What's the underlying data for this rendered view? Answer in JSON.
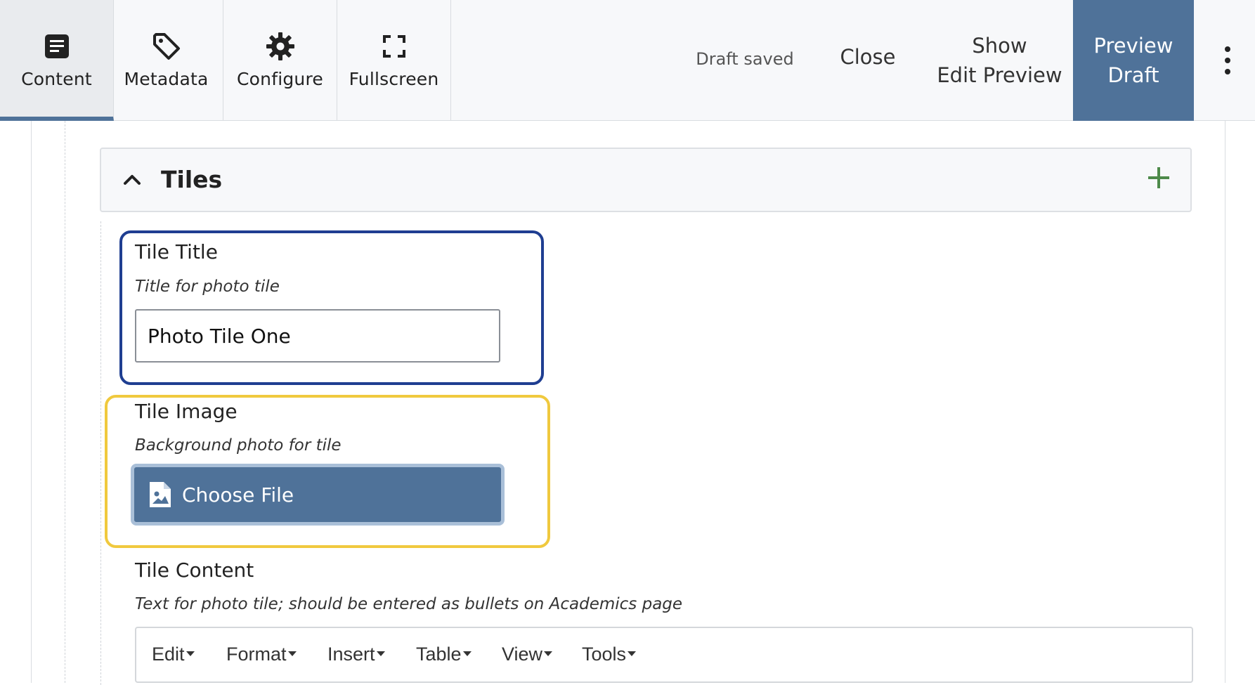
{
  "toolbar": {
    "tabs": [
      {
        "label": "Content",
        "icon": "document-icon",
        "active": true
      },
      {
        "label": "Metadata",
        "icon": "tag-icon",
        "active": false
      },
      {
        "label": "Configure",
        "icon": "gear-icon",
        "active": false
      },
      {
        "label": "Fullscreen",
        "icon": "fullscreen-icon",
        "active": false
      }
    ],
    "status": "Draft saved",
    "close_label": "Close",
    "show_preview_line1": "Show",
    "show_preview_line2": "Edit Preview",
    "preview_line1": "Preview",
    "preview_line2": "Draft"
  },
  "section": {
    "title": "Tiles"
  },
  "fields": {
    "tile_title": {
      "label": "Tile Title",
      "help": "Title for photo tile",
      "value": "Photo Tile One"
    },
    "tile_image": {
      "label": "Tile Image",
      "help": "Background photo for tile",
      "button_label": "Choose File"
    },
    "tile_content": {
      "label": "Tile Content",
      "help": "Text for photo tile; should be entered as bullets on Academics page"
    }
  },
  "editor": {
    "menus": [
      "Edit",
      "Format",
      "Insert",
      "Table",
      "View",
      "Tools"
    ]
  },
  "colors": {
    "accent": "#4f7299",
    "focus_blue": "#1f3e91",
    "highlight_yellow": "#f0c93e",
    "add_green": "#4d8a4a"
  }
}
